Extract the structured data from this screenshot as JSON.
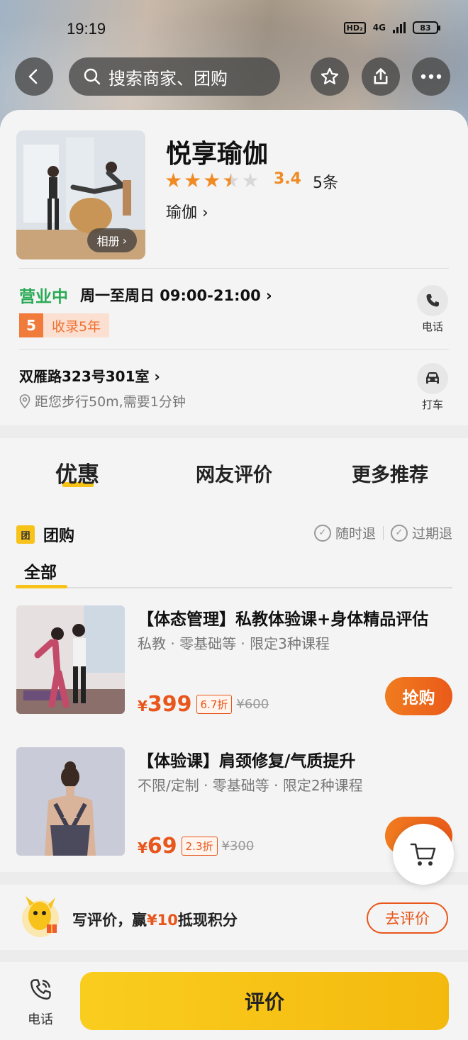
{
  "status_bar": {
    "time": "19:19",
    "hd": "HD₂",
    "network": "4G",
    "battery": "83"
  },
  "nav": {
    "search_placeholder": "搜索商家、团购"
  },
  "shop": {
    "name": "悦享瑜伽",
    "rating": "3.4",
    "rating_value": 3.4,
    "review_count": "5条",
    "category": "瑜伽",
    "album_label": "相册",
    "open_status": "营业中",
    "hours": "周一至周日 09:00-21:00",
    "years_num": "5",
    "years_label": "收录5年",
    "phone_label": "电话",
    "address": "双雁路323号301室",
    "distance": "距您步行50m,需要1分钟",
    "taxi_label": "打车"
  },
  "tabs": [
    {
      "label": "优惠",
      "active": true
    },
    {
      "label": "网友评价",
      "active": false
    },
    {
      "label": "更多推荐",
      "active": false
    }
  ],
  "group": {
    "icon_label": "团",
    "title": "团购",
    "refund_anytime": "随时退",
    "refund_expired": "过期退",
    "filter_all": "全部"
  },
  "deals": [
    {
      "title": "【体态管理】私教体验课+身体精品评估",
      "tags": "私教 · 零基础等 · 限定3种课程",
      "yen": "¥",
      "price": "399",
      "discount": "6.7折",
      "original": "¥600",
      "buy_label": "抢购"
    },
    {
      "title": "【体验课】肩颈修复/气质提升",
      "tags": "不限/定制 · 零基础等 · 限定2种课程",
      "yen": "¥",
      "price": "69",
      "discount": "2.3折",
      "original": "¥300"
    }
  ],
  "review_banner": {
    "text_prefix": "写评价，赢",
    "text_highlight": "¥10",
    "text_suffix": "抵现积分",
    "button": "去评价"
  },
  "bottom": {
    "phone_label": "电话",
    "cta": "评价"
  },
  "colors": {
    "accent_yellow": "#f7c21a",
    "price_orange": "#e8561b",
    "open_green": "#2aaa55",
    "star_orange": "#f08a24"
  }
}
